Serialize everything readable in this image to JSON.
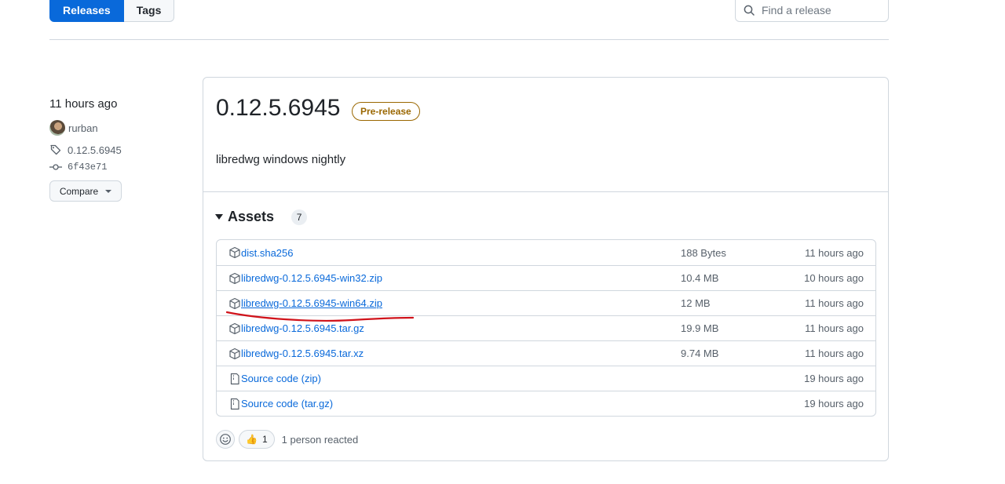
{
  "nav": {
    "tabs": [
      {
        "label": "Releases",
        "active": true
      },
      {
        "label": "Tags",
        "active": false
      }
    ],
    "search_placeholder": "Find a release"
  },
  "meta": {
    "time": "11 hours ago",
    "author": "rurban",
    "tag": "0.12.5.6945",
    "commit": "6f43e71",
    "compare_label": "Compare"
  },
  "release": {
    "title": "0.12.5.6945",
    "badge": "Pre-release",
    "description": "libredwg windows nightly",
    "assets_label": "Assets",
    "assets_count": "7",
    "assets": [
      {
        "name": "dist.sha256",
        "size": "188 Bytes",
        "time": "11 hours ago",
        "icon": "package-icon"
      },
      {
        "name": "libredwg-0.12.5.6945-win32.zip",
        "size": "10.4 MB",
        "time": "10 hours ago",
        "icon": "package-icon"
      },
      {
        "name": "libredwg-0.12.5.6945-win64.zip",
        "size": "12 MB",
        "time": "11 hours ago",
        "icon": "package-icon"
      },
      {
        "name": "libredwg-0.12.5.6945.tar.gz",
        "size": "19.9 MB",
        "time": "11 hours ago",
        "icon": "package-icon"
      },
      {
        "name": "libredwg-0.12.5.6945.tar.xz",
        "size": "9.74 MB",
        "time": "11 hours ago",
        "icon": "package-icon"
      },
      {
        "name": "Source code",
        "sub": "(zip)",
        "size": "",
        "time": "19 hours ago",
        "icon": "file-zip-icon"
      },
      {
        "name": "Source code",
        "sub": "(tar.gz)",
        "size": "",
        "time": "19 hours ago",
        "icon": "file-zip-icon"
      }
    ],
    "reaction_emoji": "👍",
    "reaction_count": "1",
    "reaction_text": "1 person reacted"
  },
  "colors": {
    "accent": "#0969da",
    "badge": "#9a6700",
    "annotation": "#d0131b"
  }
}
